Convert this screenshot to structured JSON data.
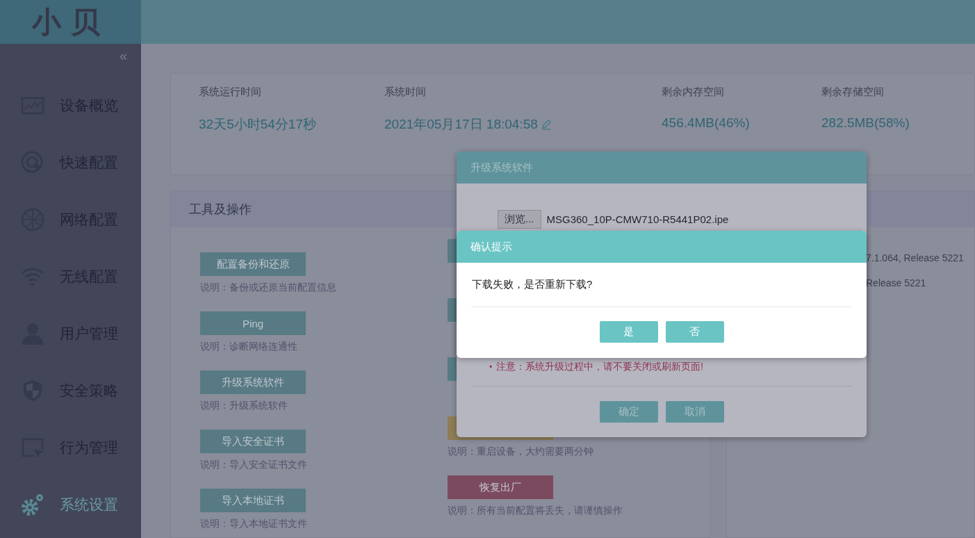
{
  "logo": "小贝",
  "sidebar": {
    "collapse": "«",
    "items": [
      {
        "label": "设备概览",
        "kind": "chart",
        "selected": false
      },
      {
        "label": "快速配置",
        "kind": "target",
        "selected": false
      },
      {
        "label": "网络配置",
        "kind": "globe",
        "selected": false
      },
      {
        "label": "无线配置",
        "kind": "wifi",
        "selected": false
      },
      {
        "label": "用户管理",
        "kind": "user",
        "selected": false
      },
      {
        "label": "安全策略",
        "kind": "shield",
        "selected": false
      },
      {
        "label": "行为管理",
        "kind": "cursor",
        "selected": false
      },
      {
        "label": "系统设置",
        "kind": "gears",
        "selected": true
      }
    ]
  },
  "stats": [
    {
      "label": "系统运行时间",
      "value": "32天5小时54分17秒",
      "editable": false
    },
    {
      "label": "系统时间",
      "value": "2021年05月17日 18:04:58",
      "editable": true
    },
    {
      "label": "剩余内存空间",
      "value": "456.4MB(46%)",
      "editable": false
    },
    {
      "label": "剩余存储空间",
      "value": "282.5MB(58%)",
      "editable": false
    }
  ],
  "tools": {
    "title": "工具及操作",
    "left": [
      {
        "label": "配置备份和还原",
        "description": "说明：备份或还原当前配置信息",
        "kind": "primary"
      },
      {
        "label": "Ping",
        "description": "说明：诊断网络连通性",
        "kind": "primary"
      },
      {
        "label": "升级系统软件",
        "description": "说明：升级系统软件",
        "kind": "primary"
      },
      {
        "label": "导入安全证书",
        "description": "说明：导入安全证书文件",
        "kind": "primary"
      },
      {
        "label": "导入本地证书",
        "description": "说明：导入本地证书文件",
        "kind": "primary"
      }
    ],
    "right": [
      {
        "kind": "primary"
      },
      {
        "kind": "primary"
      },
      {
        "kind": "primary"
      },
      {
        "kind": "warning",
        "description": "说明：重启设备，大约需要两分钟"
      },
      {
        "label": "恢复出厂",
        "description": "说明：所有当前配置将丢失，请谨慎操作",
        "kind": "danger"
      }
    ]
  },
  "info": [
    {
      "value": "7.1.064, Release 5221"
    },
    {
      "value": "Release 5221"
    }
  ],
  "upgrade_dialog": {
    "title": "升级系统软件",
    "browse": "浏览...",
    "file": "MSG360_10P-CMW710-R5441P02.ipe",
    "bullet": "•",
    "warning": "注意：系统升级过程中，请不要关闭或刷新页面!",
    "buttons": [
      "确定",
      "取消"
    ]
  },
  "confirm_dialog": {
    "title": "确认提示",
    "message": "下载失败，是否重新下载?",
    "buttons": [
      "是",
      "否"
    ]
  }
}
